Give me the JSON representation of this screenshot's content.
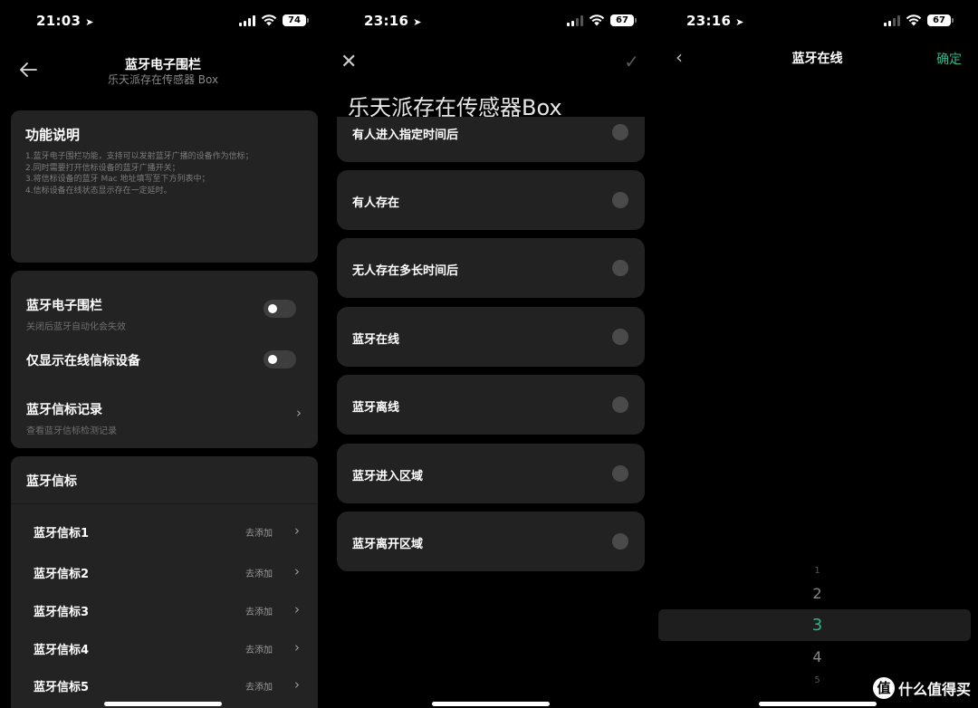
{
  "panel1": {
    "status": {
      "time": "21:03",
      "battery": "74"
    },
    "header": {
      "title": "蓝牙电子围栏",
      "subtitle": "乐天派存在传感器 Box"
    },
    "info": {
      "title": "功能说明",
      "lines": [
        "1.蓝牙电子围栏功能，支持可以发射蓝牙广播的设备作为信标；",
        "2.同时需要打开信标设备的蓝牙广播开关；",
        "3.将信标设备的蓝牙 Mac 地址填写至下方列表中；",
        "4.信标设备在线状态显示存在一定延时。"
      ]
    },
    "settings": {
      "fence_label": "蓝牙电子围栏",
      "fence_sub": "关闭后蓝牙自动化会失效",
      "online_only_label": "仅显示在线信标设备",
      "record_label": "蓝牙信标记录",
      "record_sub": "查看蓝牙信标检测记录"
    },
    "beacons": {
      "title": "蓝牙信标",
      "items": [
        {
          "name": "蓝牙信标1",
          "action": "去添加"
        },
        {
          "name": "蓝牙信标2",
          "action": "去添加"
        },
        {
          "name": "蓝牙信标3",
          "action": "去添加"
        },
        {
          "name": "蓝牙信标4",
          "action": "去添加"
        },
        {
          "name": "蓝牙信标5",
          "action": "去添加"
        }
      ]
    }
  },
  "panel2": {
    "status": {
      "time": "23:16",
      "battery": "67"
    },
    "title": "乐天派存在传感器Box",
    "options": [
      "有人进入指定时间后",
      "有人存在",
      "无人存在多长时间后",
      "蓝牙在线",
      "蓝牙离线",
      "蓝牙进入区域",
      "蓝牙离开区域"
    ]
  },
  "panel3": {
    "status": {
      "time": "23:16",
      "battery": "67"
    },
    "title": "蓝牙在线",
    "confirm": "确定",
    "picker": {
      "values": [
        "1",
        "2",
        "3",
        "4",
        "5"
      ],
      "selected": "3"
    },
    "watermark": "什么值得买",
    "watermark_logo": "值"
  },
  "colors": {
    "accent": "#2fb58c",
    "card": "#232323",
    "background": "#000000"
  }
}
